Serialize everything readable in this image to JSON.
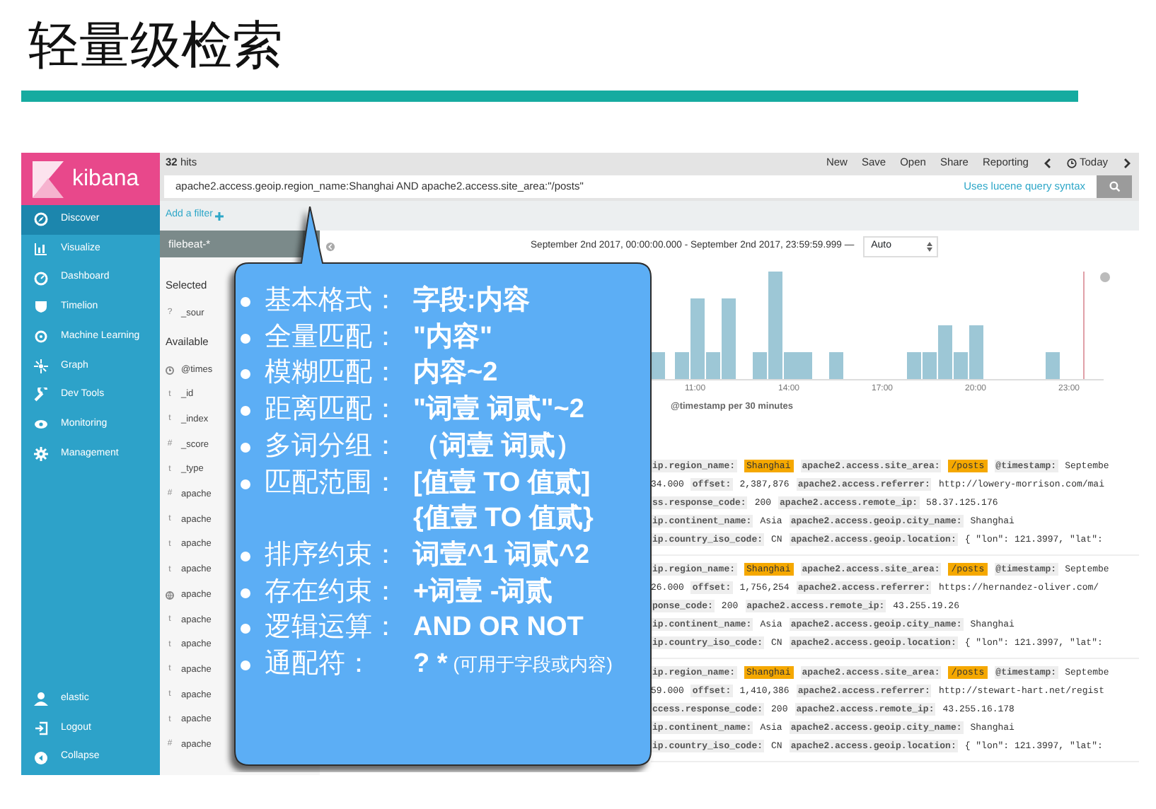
{
  "slide_title": "轻量级检索",
  "sidebar": {
    "logo": "kibana",
    "items": [
      {
        "label": "Discover",
        "selected": true
      },
      {
        "label": "Visualize",
        "selected": false
      },
      {
        "label": "Dashboard",
        "selected": false
      },
      {
        "label": "Timelion",
        "selected": false
      },
      {
        "label": "Machine Learning",
        "selected": false
      },
      {
        "label": "Graph",
        "selected": false
      },
      {
        "label": "Dev Tools",
        "selected": false
      },
      {
        "label": "Monitoring",
        "selected": false
      },
      {
        "label": "Management",
        "selected": false
      }
    ],
    "footer_items": [
      {
        "label": "elastic"
      },
      {
        "label": "Logout"
      },
      {
        "label": "Collapse"
      }
    ]
  },
  "top_bar": {
    "hits_count": "32",
    "hits_label": "hits",
    "menu": [
      "New",
      "Save",
      "Open",
      "Share",
      "Reporting"
    ],
    "time_label": "Today"
  },
  "query": {
    "value": "apache2.access.geoip.region_name:Shanghai AND apache2.access.site_area:\"/posts\"",
    "syntax_link": "Uses lucene query syntax"
  },
  "filter_link": "Add a filter",
  "index_pattern": "filebeat-*",
  "fields": [
    {
      "kind": "heading",
      "text": "Selected"
    },
    {
      "kind": "field",
      "symbol": "?",
      "text": "_sour"
    },
    {
      "kind": "heading",
      "text": "Available"
    },
    {
      "kind": "time_field",
      "text": "@times"
    },
    {
      "kind": "field",
      "symbol": "t",
      "text": "_id"
    },
    {
      "kind": "field",
      "symbol": "t",
      "text": "_index"
    },
    {
      "kind": "field",
      "symbol": "#",
      "text": "_score"
    },
    {
      "kind": "field",
      "symbol": "t",
      "text": "_type"
    },
    {
      "kind": "field",
      "symbol": "#",
      "text": "apache"
    },
    {
      "kind": "field",
      "symbol": "t",
      "text": "apache"
    },
    {
      "kind": "field",
      "symbol": "t",
      "text": "apache"
    },
    {
      "kind": "field",
      "symbol": "t",
      "text": "apache"
    },
    {
      "kind": "geo_field",
      "text": "apache"
    },
    {
      "kind": "field",
      "symbol": "t",
      "text": "apache"
    },
    {
      "kind": "field",
      "symbol": "t",
      "text": "apache"
    },
    {
      "kind": "field",
      "symbol": "t",
      "text": "apache"
    },
    {
      "kind": "field",
      "symbol": "t",
      "text": "apache"
    },
    {
      "kind": "field",
      "symbol": "t",
      "text": "apache"
    },
    {
      "kind": "field",
      "symbol": "#",
      "text": "apache"
    }
  ],
  "time_range": {
    "text": "September 2nd 2017, 00:00:00.000 - September 2nd 2017, 23:59:59.999 —",
    "interval": "Auto"
  },
  "histogram": {
    "x_labels": [
      "11:00",
      "14:00",
      "17:00",
      "20:00",
      "23:00"
    ],
    "caption": "@timestamp per 30 minutes"
  },
  "documents": [
    {
      "lines": [
        [
          {
            "kind": "key",
            "text": "ip.region_name:"
          },
          {
            "kind": "hit",
            "text": "Shanghai"
          },
          {
            "kind": "key",
            "text": "apache2.access.site_area:"
          },
          {
            "kind": "hit",
            "text": "/posts"
          },
          {
            "kind": "key",
            "text": "@timestamp:"
          },
          {
            "kind": "value",
            "text": "Septembe"
          }
        ],
        [
          {
            "kind": "value",
            "text": "34.000"
          },
          {
            "kind": "key",
            "text": "offset:"
          },
          {
            "kind": "value",
            "text": "2,387,876"
          },
          {
            "kind": "key",
            "text": "apache2.access.referrer:"
          },
          {
            "kind": "value",
            "text": "http://lowery-morrison.com/mai"
          }
        ],
        [
          {
            "kind": "key",
            "text": "ss.response_code:"
          },
          {
            "kind": "value",
            "text": "200"
          },
          {
            "kind": "key",
            "text": "apache2.access.remote_ip:"
          },
          {
            "kind": "value",
            "text": "58.37.125.176"
          }
        ],
        [
          {
            "kind": "key",
            "text": "ip.continent_name:"
          },
          {
            "kind": "value",
            "text": "Asia"
          },
          {
            "kind": "key",
            "text": "apache2.access.geoip.city_name:"
          },
          {
            "kind": "value",
            "text": "Shanghai"
          }
        ],
        [
          {
            "kind": "key",
            "text": "ip.country_iso_code:"
          },
          {
            "kind": "value",
            "text": "CN"
          },
          {
            "kind": "key",
            "text": "apache2.access.geoip.location:"
          },
          {
            "kind": "value",
            "text": "{ \"lon\": 121.3997, \"lat\":"
          }
        ]
      ]
    },
    {
      "lines": [
        [
          {
            "kind": "key",
            "text": "ip.region_name:"
          },
          {
            "kind": "hit",
            "text": "Shanghai"
          },
          {
            "kind": "key",
            "text": "apache2.access.site_area:"
          },
          {
            "kind": "hit",
            "text": "/posts"
          },
          {
            "kind": "key",
            "text": "@timestamp:"
          },
          {
            "kind": "value",
            "text": "Septembe"
          }
        ],
        [
          {
            "kind": "value",
            "text": "26.000"
          },
          {
            "kind": "key",
            "text": "offset:"
          },
          {
            "kind": "value",
            "text": "1,756,254"
          },
          {
            "kind": "key",
            "text": "apache2.access.referrer:"
          },
          {
            "kind": "value",
            "text": "https://hernandez-oliver.com/"
          }
        ],
        [
          {
            "kind": "key",
            "text": "ponse_code:"
          },
          {
            "kind": "value",
            "text": "200"
          },
          {
            "kind": "key",
            "text": "apache2.access.remote_ip:"
          },
          {
            "kind": "value",
            "text": "43.255.19.26"
          }
        ],
        [
          {
            "kind": "key",
            "text": "ip.continent_name:"
          },
          {
            "kind": "value",
            "text": "Asia"
          },
          {
            "kind": "key",
            "text": "apache2.access.geoip.city_name:"
          },
          {
            "kind": "value",
            "text": "Shanghai"
          }
        ],
        [
          {
            "kind": "key",
            "text": "ip.country_iso_code:"
          },
          {
            "kind": "value",
            "text": "CN"
          },
          {
            "kind": "key",
            "text": "apache2.access.geoip.location:"
          },
          {
            "kind": "value",
            "text": "{ \"lon\": 121.3997, \"lat\":"
          }
        ]
      ]
    },
    {
      "lines": [
        [
          {
            "kind": "key",
            "text": "ip.region_name:"
          },
          {
            "kind": "hit",
            "text": "Shanghai"
          },
          {
            "kind": "key",
            "text": "apache2.access.site_area:"
          },
          {
            "kind": "hit",
            "text": "/posts"
          },
          {
            "kind": "key",
            "text": "@timestamp:"
          },
          {
            "kind": "value",
            "text": "Septembe"
          }
        ],
        [
          {
            "kind": "value",
            "text": "59.000"
          },
          {
            "kind": "key",
            "text": "offset:"
          },
          {
            "kind": "value",
            "text": "1,410,386"
          },
          {
            "kind": "key",
            "text": "apache2.access.referrer:"
          },
          {
            "kind": "value",
            "text": "http://stewart-hart.net/regist"
          }
        ],
        [
          {
            "kind": "key",
            "text": "ccess.response_code:"
          },
          {
            "kind": "value",
            "text": "200"
          },
          {
            "kind": "key",
            "text": "apache2.access.remote_ip:"
          },
          {
            "kind": "value",
            "text": "43.255.16.178"
          }
        ],
        [
          {
            "kind": "key",
            "text": "ip.continent_name:"
          },
          {
            "kind": "value",
            "text": "Asia"
          },
          {
            "kind": "key",
            "text": "apache2.access.geoip.city_name:"
          },
          {
            "kind": "value",
            "text": "Shanghai"
          }
        ],
        [
          {
            "kind": "key",
            "text": "ip.country_iso_code:"
          },
          {
            "kind": "value",
            "text": "CN"
          },
          {
            "kind": "key",
            "text": "apache2.access.geoip.location:"
          },
          {
            "kind": "value",
            "text": "{ \"lon\": 121.3997, \"lat\":"
          }
        ]
      ]
    }
  ],
  "callout": {
    "items": [
      {
        "label": "基本格式：",
        "values": [
          "字段:内容"
        ]
      },
      {
        "label": "全量匹配：",
        "values": [
          "\"内容\""
        ]
      },
      {
        "label": "模糊匹配：",
        "values": [
          "内容~2"
        ]
      },
      {
        "label": "距离匹配：",
        "values": [
          "\"词壹 词贰\"~2"
        ]
      },
      {
        "label": "多词分组：",
        "values": [
          "（词壹 词贰）"
        ]
      },
      {
        "label": "匹配范围：",
        "values": [
          "[值壹 TO 值贰]",
          "{值壹 TO 值贰}"
        ]
      },
      {
        "label": "排序约束：",
        "values": [
          "词壹^1 词贰^2"
        ]
      },
      {
        "label": "存在约束：",
        "values": [
          "+词壹 -词贰"
        ]
      },
      {
        "label": "逻辑运算：",
        "values": [
          "AND OR NOT"
        ]
      },
      {
        "label": "通配符：",
        "values": [
          "? *"
        ],
        "note": "(可用于字段或内容)"
      }
    ]
  }
}
